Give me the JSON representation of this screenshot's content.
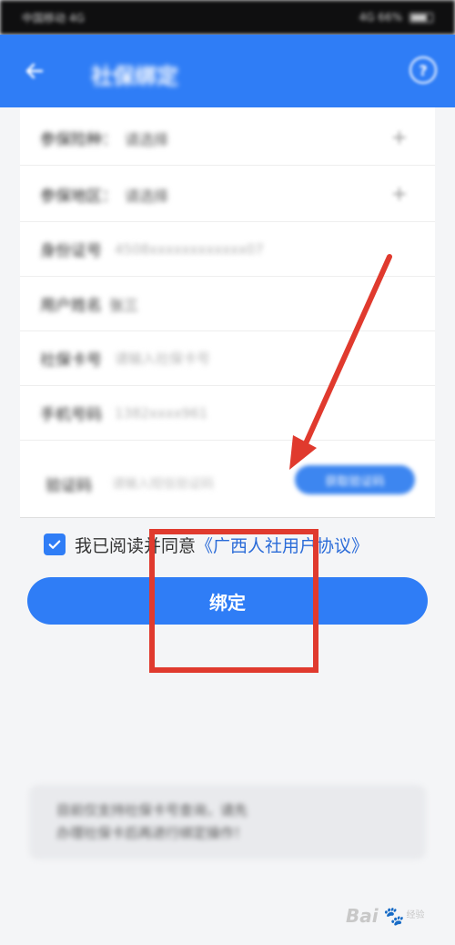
{
  "status_bar": {
    "left": "中国移动 4G",
    "right": "4G 66%"
  },
  "app_bar": {
    "title": "社保绑定",
    "back_icon": "back-arrow-icon",
    "help_icon": "question-circle-icon",
    "color": "#2f7df6"
  },
  "form": {
    "rows": [
      {
        "label": "参保险种：",
        "value": "请选择",
        "icon": "plus-icon"
      },
      {
        "label": "参保地区：",
        "value": "请选择",
        "icon": "plus-icon"
      },
      {
        "label": "身份证号",
        "placeholder": "4508xxxxxxxxxxxx07"
      },
      {
        "label": "用户姓名",
        "value": "张三"
      },
      {
        "label": "社保卡号",
        "placeholder": "请输入社保卡号"
      },
      {
        "label": "手机号码",
        "placeholder": "1382xxxx961"
      }
    ],
    "code": {
      "label": "验证码",
      "placeholder": "请输入短信验证码",
      "button": "获取验证码"
    }
  },
  "agreement": {
    "checked": true,
    "text": "我已阅读并同意",
    "link": "《广西人社用户协议》"
  },
  "bind_button": "绑定",
  "note": {
    "line1": "目前仅支持社保卡号查询，请先",
    "line2": "办理社保卡后再进行绑定操作！"
  },
  "annotations": {
    "arrow_color": "#e03a2e",
    "box_color": "#e03a2e"
  },
  "watermark": {
    "text": "Bai",
    "sub": "经验"
  }
}
